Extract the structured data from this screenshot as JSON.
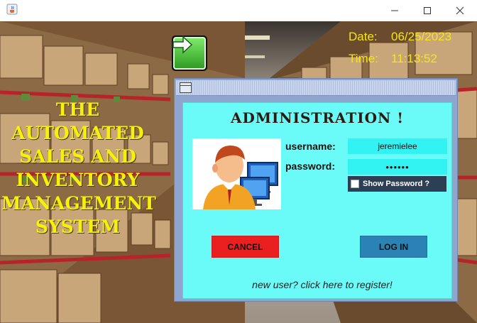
{
  "window": {
    "app_icon": "java-cup-icon",
    "controls": {
      "minimize": "minimize-icon",
      "maximize": "maximize-icon",
      "close": "close-icon"
    }
  },
  "background": {
    "theme": "warehouse-shelves"
  },
  "headline": [
    "THE AUTOMATED",
    "SALES AND",
    "INVENTORY",
    "MANAGEMENT",
    "SYSTEM"
  ],
  "nav": {
    "next_icon": "right-arrow-icon"
  },
  "clock": {
    "date_label": "Date:",
    "date_value": "06/25/2023",
    "time_label": "Time:",
    "time_value": "11:13:52"
  },
  "dialog": {
    "title": "ADMINISTRATION !",
    "avatar_icon": "user-computer-icon",
    "username_label": "username:",
    "username_value": "jeremielee",
    "password_label": "password:",
    "password_value": "••••••",
    "show_password_label": "Show Password ?",
    "show_password_checked": false,
    "cancel_label": "CANCEL",
    "login_label": "LOG IN",
    "register_text": "new user? click here to register!"
  },
  "colors": {
    "headline": "#f6f10a",
    "clock": "#f4e51c",
    "dialog_body": "#6afbf8",
    "field_bg": "#33f3f2",
    "cancel": "#ea2020",
    "login": "#2a83b4",
    "show_password_bg": "#2d3f55"
  }
}
